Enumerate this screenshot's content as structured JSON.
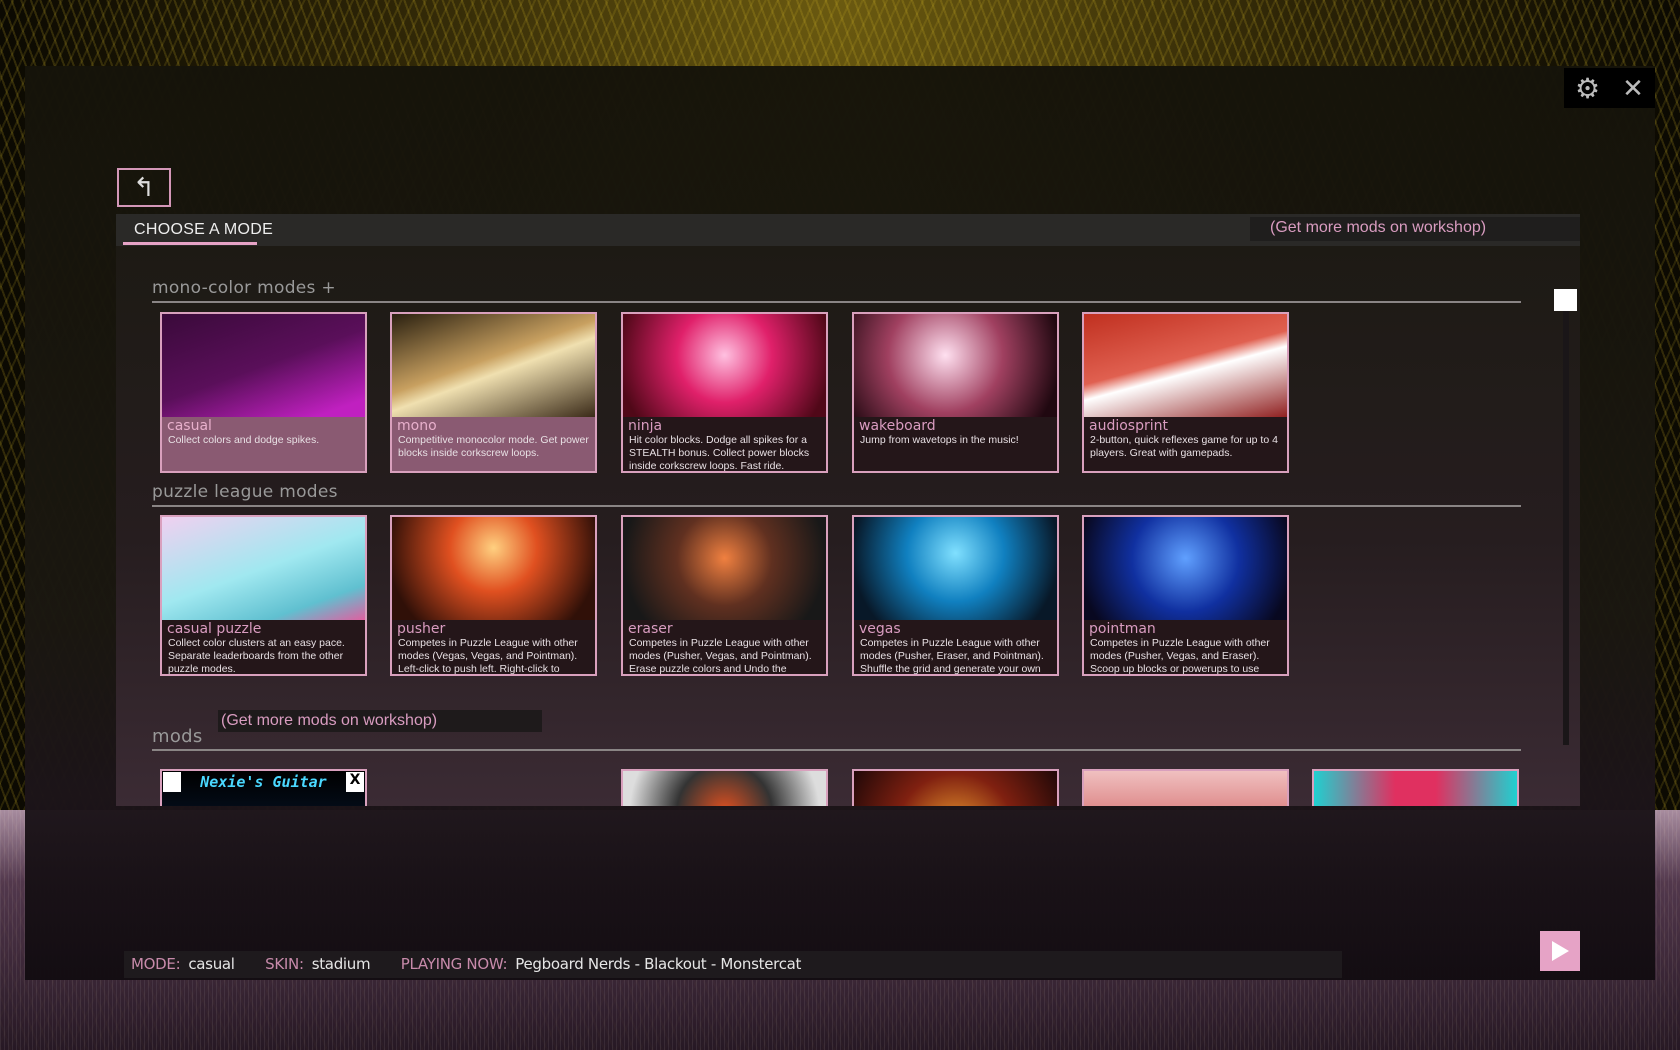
{
  "top": {
    "settings_icon": "gear-icon",
    "close_icon": "close-icon"
  },
  "back": {
    "icon": "back-arrow-icon",
    "glyph": "↰"
  },
  "header": {
    "title": "CHOOSE A MODE",
    "workshop_link": "(Get more mods on workshop)"
  },
  "sections": [
    {
      "title": "mono-color modes +",
      "cards": [
        {
          "name": "casual",
          "desc": "Collect colors and dodge spikes.",
          "selected": true,
          "thumb": "linear-gradient(160deg,#3a0a3a,#5a0f5a 50%,#c020c0 90%)"
        },
        {
          "name": "mono",
          "desc": "Competitive monocolor mode. Get power blocks inside corkscrew loops.",
          "selected": true,
          "thumb": "linear-gradient(160deg,#2a2010,#c8a060 45%,#f0e0b0 55%,#3a2a18)"
        },
        {
          "name": "ninja",
          "desc": "Hit color blocks. Dodge all spikes for a STEALTH bonus. Collect power blocks inside corkscrew loops. Fast ride.",
          "selected": false,
          "thumb": "radial-gradient(circle at 50% 40%,#ffc0e0,#e0206a 40%,#500818 90%)"
        },
        {
          "name": "wakeboard",
          "desc": "Jump from wavetops in the music!",
          "selected": false,
          "thumb": "radial-gradient(circle at 45% 40%,#ffe0f0,#a04060 45%,#200810 90%)"
        },
        {
          "name": "audiosprint",
          "desc": "2-button, quick reflexes game for up to 4 players. Great with gamepads.",
          "selected": false,
          "thumb": "linear-gradient(165deg,#c03020,#e06050 45%,#ffffff 55%,#902020)"
        }
      ]
    },
    {
      "title": "puzzle league modes",
      "cards": [
        {
          "name": "casual puzzle",
          "desc": "Collect color clusters at an easy pace. Separate leaderboards from the other puzzle modes.",
          "selected": false,
          "thumb": "linear-gradient(160deg,#f0d0f0,#a0e8f0 50%,#60c0d0 80%,#e060a0)"
        },
        {
          "name": "pusher",
          "desc": "Competes in Puzzle League with other modes (Vegas, Vegas, and Pointman). Left-click to push left. Right-click to",
          "selected": false,
          "thumb": "radial-gradient(circle at 50% 30%,#ffd080,#e05020 35%,#301008 85%)"
        },
        {
          "name": "eraser",
          "desc": "Competes in Puzzle League with other modes (Pusher, Vegas, and Pointman). Erase puzzle colors and Undo the",
          "selected": false,
          "thumb": "radial-gradient(circle at 50% 40%,#f08040,#603020 40%,#181818 85%)"
        },
        {
          "name": "vegas",
          "desc": "Competes in Puzzle League with other modes (Pusher, Eraser, and Pointman). Shuffle the grid and generate your own",
          "selected": false,
          "thumb": "radial-gradient(circle at 50% 35%,#80e0ff,#1080c0 40%,#081828 85%)"
        },
        {
          "name": "pointman",
          "desc": "Competes in Puzzle League with other modes (Pusher, Vegas, and Eraser). Scoop up blocks or powerups to use",
          "selected": false,
          "thumb": "radial-gradient(circle at 50% 40%,#60a0ff,#1030a0 45%,#080820 90%)"
        }
      ]
    }
  ],
  "mods": {
    "title": "mods",
    "workshop_link": "(Get more mods on workshop)",
    "cards": [
      {
        "name": "Nexie's Guitar",
        "thumb": "linear-gradient(#000,#0a2040)",
        "slot": 0
      },
      {
        "name": "",
        "thumb": "radial-gradient(circle at 50% 40%,#e05020,#333 40%,#ddd 80%)",
        "slot": 2
      },
      {
        "name": "",
        "thumb": "radial-gradient(circle at 50% 60%,#f0a030,#802010 50%,#200808)",
        "slot": 3
      },
      {
        "name": "",
        "thumb": "linear-gradient(#f0c0c0,#c03030)",
        "slot": 4
      },
      {
        "name": "",
        "thumb": "linear-gradient(90deg,#20d0d0,#e03060 40%,#e03060 60%,#20d0d0)",
        "slot": 5
      }
    ]
  },
  "status": {
    "mode_label": "MODE:",
    "mode": "casual",
    "skin_label": "SKIN:",
    "skin": "stadium",
    "playing_label": "PLAYING NOW:",
    "playing": "Pegboard Nerds - Blackout - Monstercat"
  },
  "colors": {
    "accent": "#e6a3c6",
    "accent_text": "#d99cc0"
  }
}
